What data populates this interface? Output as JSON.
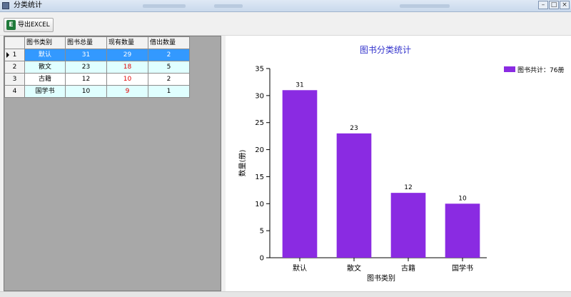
{
  "window": {
    "title": "分类统计"
  },
  "toolbar": {
    "export_label": "导出EXCEL",
    "export_icon": "excel-icon"
  },
  "grid": {
    "columns": [
      "图书类别",
      "图书总量",
      "现有数量",
      "借出数量"
    ],
    "rows": [
      {
        "index": "1",
        "category": "默认",
        "total": "31",
        "available": "29",
        "lent": "2",
        "selected": true
      },
      {
        "index": "2",
        "category": "散文",
        "total": "23",
        "available": "18",
        "lent": "5",
        "available_highlight": true
      },
      {
        "index": "3",
        "category": "古籍",
        "total": "12",
        "available": "10",
        "lent": "2",
        "available_highlight": true
      },
      {
        "index": "4",
        "category": "国学书",
        "total": "10",
        "available": "9",
        "lent": "1",
        "available_highlight": true
      }
    ]
  },
  "chart_data": {
    "type": "bar",
    "title": "图书分类统计",
    "categories": [
      "默认",
      "散文",
      "古籍",
      "国学书"
    ],
    "values": [
      31,
      23,
      12,
      10
    ],
    "data_labels": [
      "31",
      "23",
      "12",
      "10"
    ],
    "xlabel": "图书类别",
    "ylabel": "数量(册)",
    "ylim": [
      0,
      35
    ],
    "yticks": [
      0,
      5,
      10,
      15,
      20,
      25,
      30,
      35
    ],
    "legend": {
      "label": "图书共计：76册",
      "position": "top-right"
    },
    "grid": false,
    "colors": {
      "bar": "#8a2be2",
      "title": "#3333cc",
      "available_highlight": "#e00000",
      "selected_row": "#3399ff"
    }
  }
}
